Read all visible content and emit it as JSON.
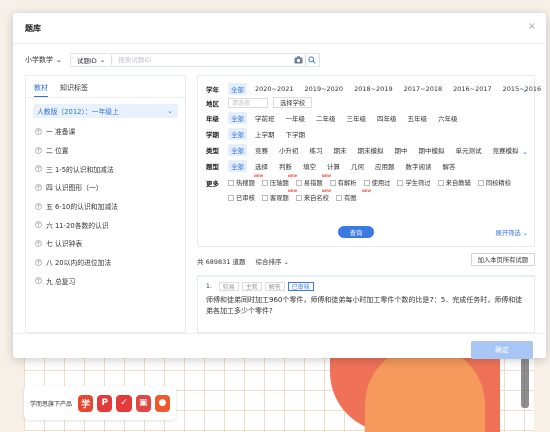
{
  "dialog": {
    "title": "题库",
    "close": "×",
    "subject": "小学数学",
    "search_type": "试题ID",
    "search_placeholder": "搜索试题ID"
  },
  "left": {
    "tabs": [
      "教材",
      "知识标签"
    ],
    "version": "人教版（2012）：一年级上",
    "chapters": [
      "一 准备课",
      "二 位置",
      "三 1-5的认识和加减法",
      "四 认识图形（一）",
      "五 6-10的认识和加减法",
      "六 11-20各数的认识",
      "七 认识钟表",
      "八 20以内的进位加法",
      "九 总复习"
    ]
  },
  "filters": {
    "year": {
      "label": "学年",
      "options": [
        "全部",
        "2020~2021",
        "2019~2020",
        "2018~2019",
        "2017~2018",
        "2016~2017",
        "2015~2016"
      ]
    },
    "region": {
      "label": "地区",
      "select_placeholder": "请选择",
      "button": "选择学校"
    },
    "grade": {
      "label": "年级",
      "options": [
        "全部",
        "学前班",
        "一年级",
        "二年级",
        "三年级",
        "四年级",
        "五年级",
        "六年级"
      ]
    },
    "term": {
      "label": "学期",
      "options": [
        "全部",
        "上学期",
        "下学期"
      ]
    },
    "type": {
      "label": "类型",
      "options": [
        "全部",
        "竞赛",
        "小升初",
        "练习",
        "期末",
        "期末模拟",
        "期中",
        "期中模拟",
        "单元测试",
        "竞赛模拟"
      ]
    },
    "question_type": {
      "label": "题型",
      "options": [
        "全部",
        "选择",
        "判断",
        "填空",
        "计算",
        "几何",
        "应用题",
        "数字阅读",
        "解答"
      ]
    },
    "more": {
      "label": "更多",
      "row1": [
        "热搜题",
        "压轴题",
        "易错题",
        "有解析",
        "使用过",
        "学生筛过",
        "来自教辅",
        "同校精校"
      ],
      "row2": [
        "已审核",
        "客观题",
        "来自名校",
        "有图"
      ],
      "hot_badge": "NEW"
    },
    "query_button": "查询",
    "expand": "展开筛选"
  },
  "results": {
    "count_text": "共 689831 道题",
    "sort": "综合排序",
    "add_all": "加入本页所有试题"
  },
  "question": {
    "number": "1.",
    "tags": [
      "较易",
      "主观",
      "解答",
      "已审核"
    ],
    "text": "师傅和徒弟同时加工960个零件，师傅和徒弟每小时加工零件个数的比是7：5．完成任务时，师傅和徒弟各加工多少个零件?"
  },
  "footer": {
    "confirm": "确定"
  },
  "bottom_bar": {
    "label": "学而思旗下产品",
    "products": [
      {
        "icon": "xue-logo-icon",
        "glyph": "学",
        "color": "#e8452f"
      },
      {
        "icon": "app-logo-icon",
        "glyph": "P",
        "color": "#e23b3b"
      },
      {
        "icon": "check-logo-icon",
        "glyph": "✓",
        "color": "#e33a3a"
      },
      {
        "icon": "camera-logo-icon",
        "glyph": "▣",
        "color": "#e04848"
      },
      {
        "icon": "live-logo-icon",
        "glyph": "●",
        "color": "#ef5a2c"
      }
    ]
  }
}
